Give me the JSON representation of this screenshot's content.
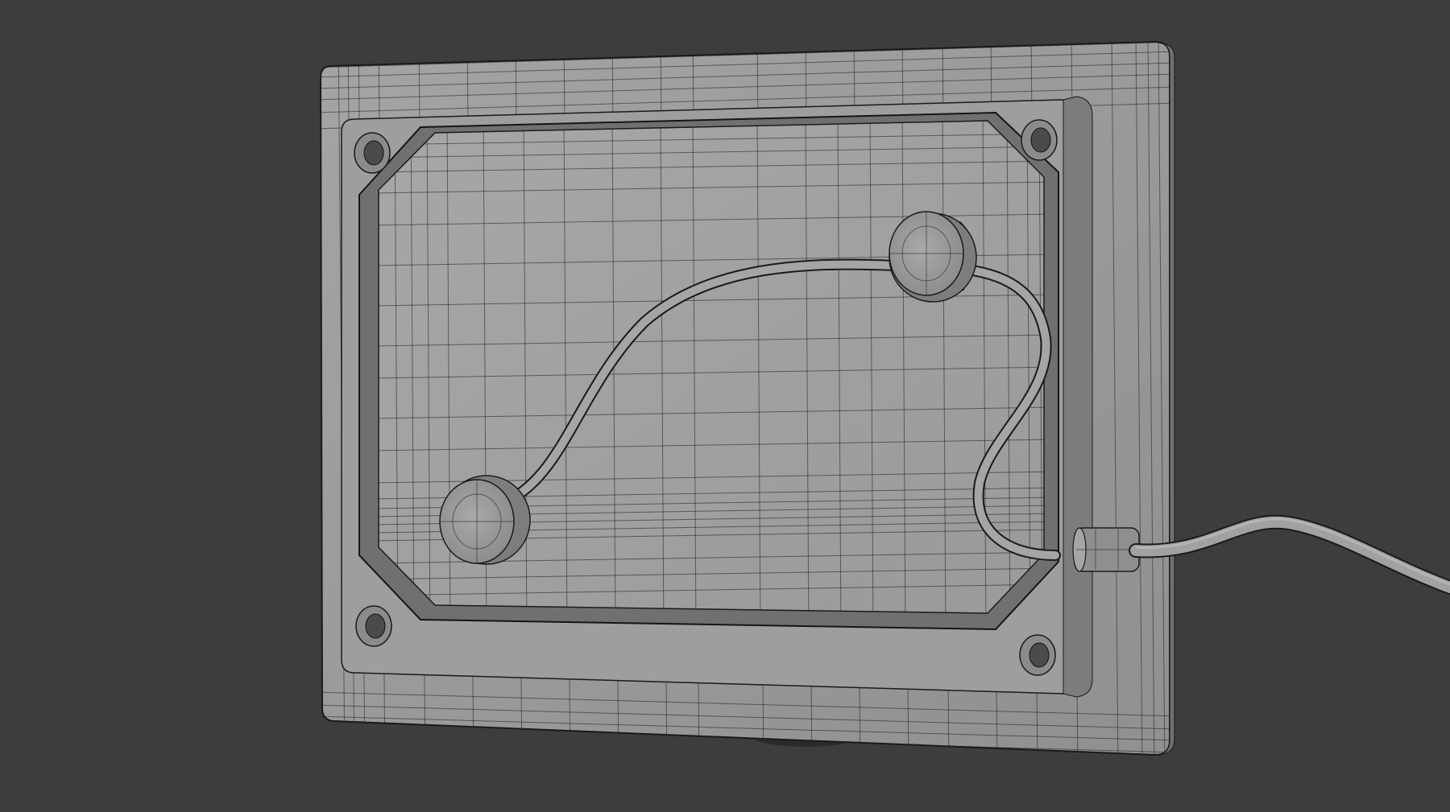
{
  "viewport": {
    "background_color": "#3d3d3d",
    "shading": "solid-gray-with-wireframe-overlay"
  },
  "model": {
    "surface_color": "#9a9c9a",
    "wire_color": "#1e1e1e",
    "parts": [
      {
        "name": "outer-frame",
        "kind": "rounded-plate"
      },
      {
        "name": "inner-panel",
        "kind": "recessed-octagonal-panel"
      },
      {
        "name": "mounting-hole-top-left",
        "kind": "screw-hole"
      },
      {
        "name": "mounting-hole-top-right",
        "kind": "screw-hole"
      },
      {
        "name": "mounting-hole-bottom-left",
        "kind": "screw-hole"
      },
      {
        "name": "mounting-hole-bottom-right",
        "kind": "screw-hole"
      },
      {
        "name": "sensor-disc-upper",
        "kind": "cylinder"
      },
      {
        "name": "sensor-disc-lower",
        "kind": "cylinder"
      },
      {
        "name": "internal-cable",
        "kind": "tube"
      },
      {
        "name": "cable-grommet",
        "kind": "cylinder"
      },
      {
        "name": "external-cable",
        "kind": "tube"
      },
      {
        "name": "rear-stand",
        "kind": "base"
      }
    ]
  }
}
